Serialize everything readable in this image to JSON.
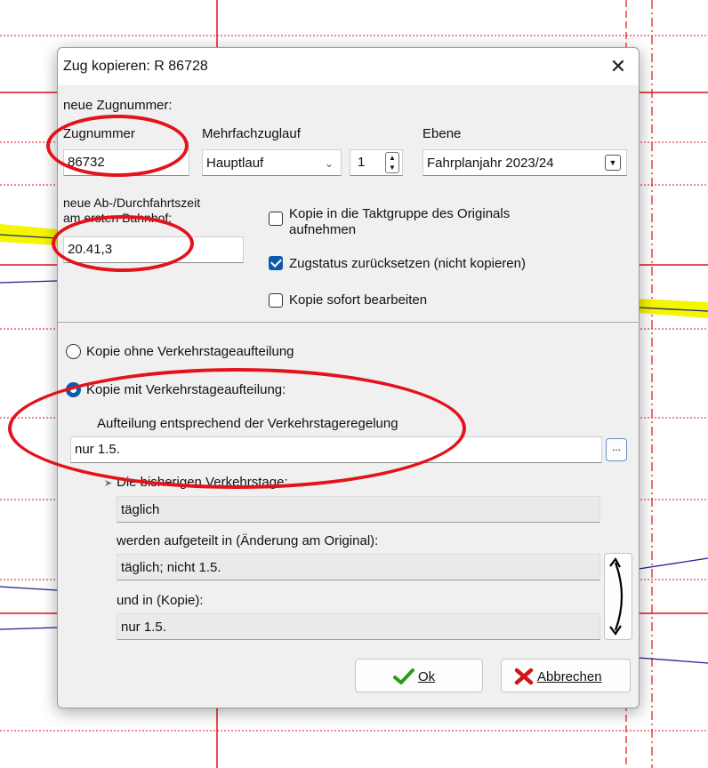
{
  "dialog": {
    "title": "Zug kopieren: R 86728",
    "close_symbol": "✕",
    "section_new_number": "neue Zugnummer:",
    "zugnummer_label": "Zugnummer",
    "zugnummer_value": "86732",
    "mehrfach_label": "Mehrfachzuglauf",
    "mehrfach_value": "Hauptlauf",
    "mehrfach_count": "1",
    "ebene_label": "Ebene",
    "ebene_value": "Fahrplanjahr 2023/24",
    "time_label_line1": "neue Ab-/Durchfahrtszeit",
    "time_label_line2": "am ersten Bahnhof:",
    "time_value": "20.41,3",
    "cb_taktgruppe_line1": "Kopie in die Taktgruppe des Originals",
    "cb_taktgruppe_line2": "aufnehmen",
    "cb_taktgruppe_checked": false,
    "cb_zugstatus": "Zugstatus zurücksetzen (nicht kopieren)",
    "cb_zugstatus_checked": true,
    "cb_sofort": "Kopie sofort bearbeiten",
    "cb_sofort_checked": false,
    "radio_ohne": "Kopie ohne Verkehrstageaufteilung",
    "radio_mit": "Kopie mit Verkehrstageaufteilung:",
    "radio_selected": "mit",
    "aufteilung_label": "Aufteilung entsprechend der Verkehrstageregelung",
    "aufteilung_value": "nur 1.5.",
    "browse_label": "...",
    "bisher_label": "Die bisherigen Verkehrstage:",
    "bisher_value": "täglich",
    "aufgeteilt_label": "werden aufgeteilt in (Änderung am Original):",
    "aufgeteilt_value": "täglich; nicht 1.5.",
    "kopie_label": "und in (Kopie):",
    "kopie_value": "nur 1.5.",
    "ok_label": "Ok",
    "cancel_label": "Abbrechen"
  },
  "colors": {
    "accent": "#0b5cad",
    "annotation": "#e3121b",
    "graph_red": "#e3121b",
    "graph_blue": "#1e1e8c",
    "highlight": "#f5f500"
  },
  "icons": {
    "ok": "green-check-icon",
    "cancel": "red-x-icon",
    "swap": "curved-double-arrow-icon"
  }
}
